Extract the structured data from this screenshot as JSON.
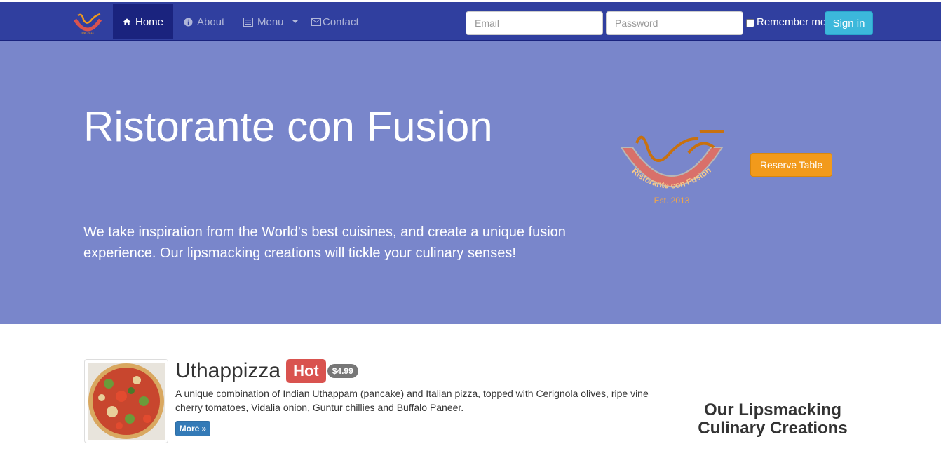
{
  "navbar": {
    "brand_logo_text": "Est. 2013",
    "items": [
      {
        "label": "Home",
        "icon": "home-icon",
        "active": true
      },
      {
        "label": "About",
        "icon": "info-icon"
      },
      {
        "label": "Menu",
        "icon": "list-icon"
      },
      {
        "label": "Contact",
        "icon": "envelope-icon"
      }
    ],
    "email_placeholder": "Email",
    "password_placeholder": "Password",
    "remember_label": "Remember me",
    "signin_label": "Sign in"
  },
  "jumbotron": {
    "title": "Ristorante con Fusion",
    "text": "We take inspiration from the World's best cuisines, and create a unique fusion experience. Our lipsmacking creations will tickle your culinary senses!",
    "logo_text": "Ristorante con Fusion",
    "logo_est": "Est. 2013",
    "reserve_label": "Reserve Table"
  },
  "featured": {
    "name": "Uthappizza",
    "badge": "Hot",
    "price": "$4.99",
    "description": "A unique combination of Indian Uthappam (pancake) and Italian pizza, topped with Cerignola olives, ripe vine cherry tomatoes, Vidalia onion, Guntur chillies and Buffalo Paneer.",
    "more_label": "More »"
  },
  "side": {
    "heading": "Our Lipsmacking Culinary Creations"
  },
  "colors": {
    "navbar": "#303f9f",
    "navbar_active": "#1a237e",
    "jumbotron": "#7986cb",
    "signin": "#3cb8db",
    "reserve": "#f29a1b",
    "hot_badge": "#d9534f"
  }
}
